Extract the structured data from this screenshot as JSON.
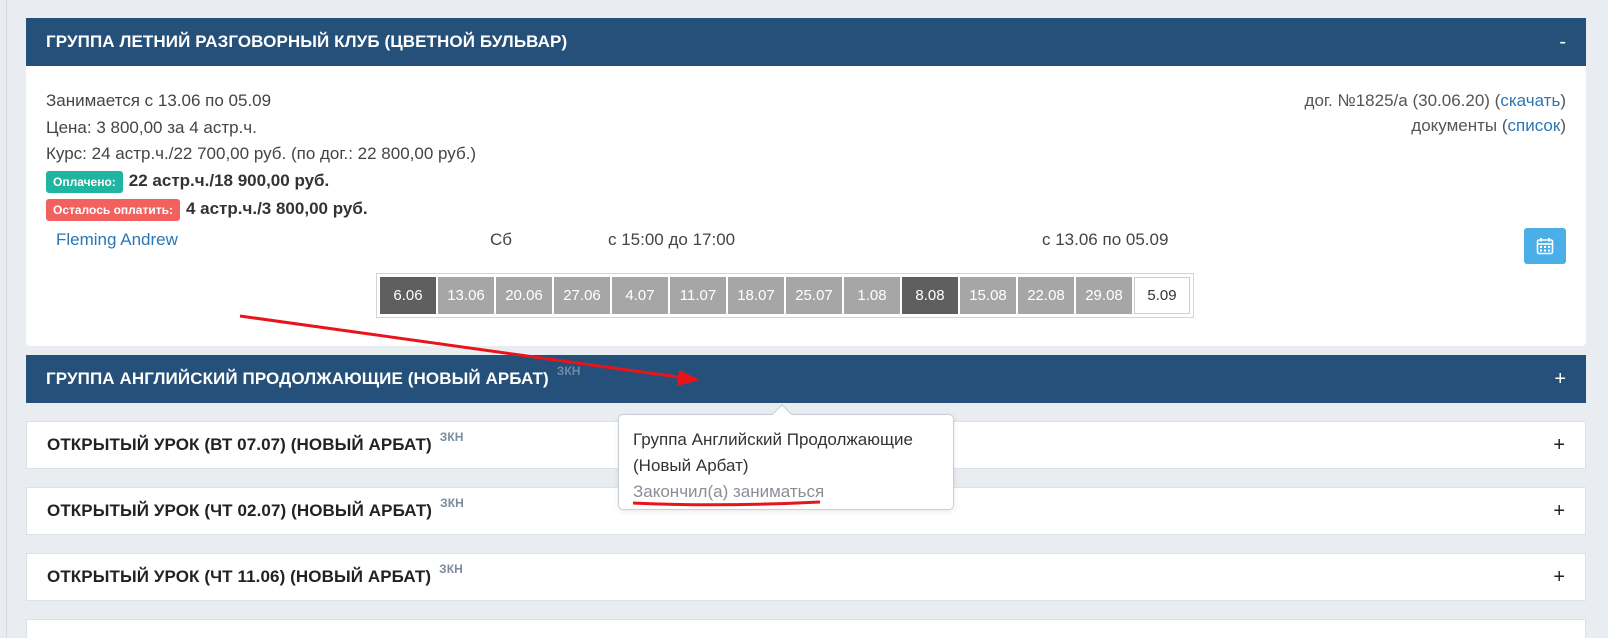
{
  "group1": {
    "title": "ГРУППА ЛЕТНИЙ РАЗГОВОРНЫЙ КЛУБ (ЦВЕТНОЙ БУЛЬВАР)",
    "toggle": "-",
    "schedule": "Занимается с 13.06 по 05.09",
    "price": "Цена: 3 800,00 за 4 астр.ч.",
    "course": "Курс: 24 астр.ч./22 700,00 руб. (по дог.: 22 800,00 руб.)",
    "paid_label": "Оплачено:",
    "paid_value": "22 астр.ч./18 900,00 руб.",
    "due_label": "Осталось оплатить:",
    "due_value": "4 астр.ч./3 800,00 руб.",
    "contract_text": "дог. №1825/а (30.06.20) (",
    "contract_link": "скачать",
    "contract_close": ")",
    "docs_text": "документы (",
    "docs_link": "список",
    "docs_close": ")",
    "teacher": "Fleming Andrew",
    "weekday": "Сб",
    "time": "с 15:00 до 17:00",
    "period": "с 13.06 по 05.09",
    "calendar_icon": "calendar-icon",
    "dates": [
      {
        "label": "6.06",
        "state": "dark"
      },
      {
        "label": "13.06",
        "state": "grey"
      },
      {
        "label": "20.06",
        "state": "grey"
      },
      {
        "label": "27.06",
        "state": "grey"
      },
      {
        "label": "4.07",
        "state": "grey"
      },
      {
        "label": "11.07",
        "state": "grey"
      },
      {
        "label": "18.07",
        "state": "grey"
      },
      {
        "label": "25.07",
        "state": "grey"
      },
      {
        "label": "1.08",
        "state": "grey"
      },
      {
        "label": "8.08",
        "state": "dark"
      },
      {
        "label": "15.08",
        "state": "grey"
      },
      {
        "label": "22.08",
        "state": "grey"
      },
      {
        "label": "29.08",
        "state": "grey"
      },
      {
        "label": "5.09",
        "state": "current"
      }
    ]
  },
  "group2": {
    "title": "ГРУППА АНГЛИЙСКИЙ ПРОДОЛЖАЮЩИЕ (НОВЫЙ АРБАТ)",
    "tag": "ЗКН",
    "toggle": "+"
  },
  "lesson1": {
    "title": "ОТКРЫТЫЙ УРОК (ВТ 07.07) (НОВЫЙ АРБАТ)",
    "tag": "ЗКН",
    "toggle": "+"
  },
  "lesson2": {
    "title": "ОТКРЫТЫЙ УРОК (ЧТ 02.07) (НОВЫЙ АРБАТ)",
    "tag": "ЗКН",
    "toggle": "+"
  },
  "lesson3": {
    "title": "ОТКРЫТЫЙ УРОК (ЧТ 11.06) (НОВЫЙ АРБАТ)",
    "tag": "ЗКН",
    "toggle": "+"
  },
  "popover": {
    "line1": "Группа Английский Продолжающие",
    "line2": "(Новый Арбат)",
    "status": "Закончил(а) заниматься"
  },
  "colors": {
    "header": "#24507a",
    "paid": "#1fb5a0",
    "due": "#f2615d",
    "annotation": "#e8141b",
    "calendar_button": "#4aaee9"
  }
}
